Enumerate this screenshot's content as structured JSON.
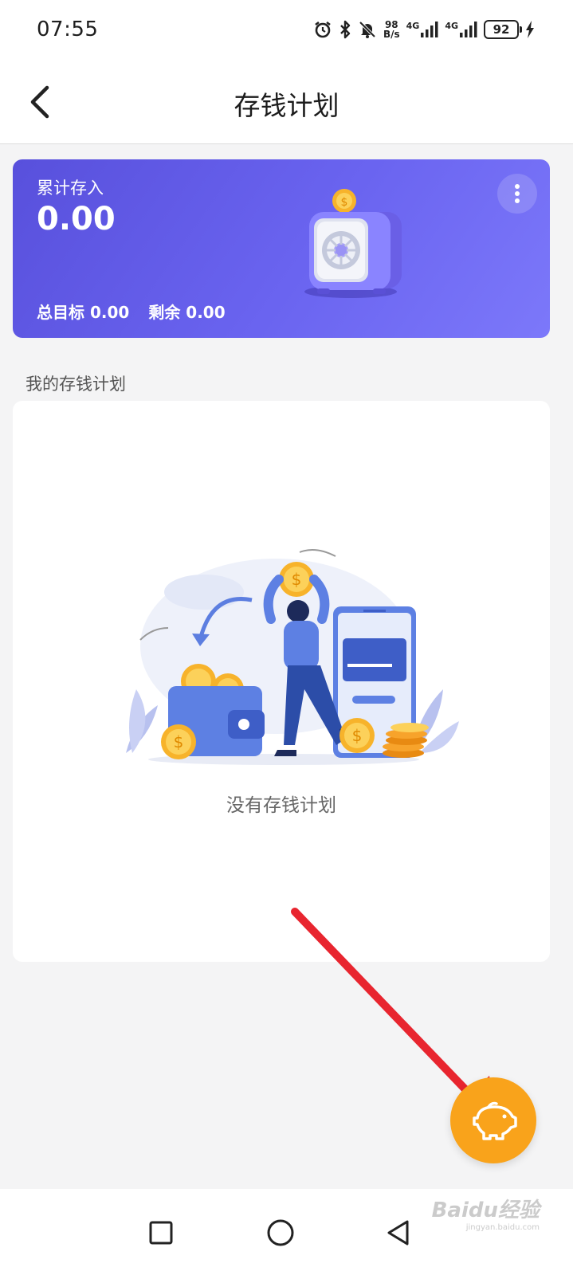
{
  "status_bar": {
    "time": "07:55",
    "net_speed_value": "98",
    "net_speed_unit": "B/s",
    "signal_1_label": "4G",
    "signal_2_label": "4G",
    "battery": "92",
    "icons": [
      "alarm-icon",
      "bluetooth-icon",
      "mute-bell-icon",
      "signal-icon",
      "battery-icon",
      "charging-icon"
    ]
  },
  "header": {
    "title": "存钱计划",
    "back_icon": "chevron-left-icon"
  },
  "summary": {
    "label": "累计存入",
    "amount": "0.00",
    "target_label": "总目标",
    "target_value": "0.00",
    "remaining_label": "剩余",
    "remaining_value": "0.00",
    "more_icon": "more-vertical-icon"
  },
  "plans": {
    "section_title": "我的存钱计划",
    "empty_text": "没有存钱计划"
  },
  "fab": {
    "icon": "piggy-bank-icon"
  },
  "nav": {
    "icons": [
      "recent-apps-icon",
      "home-icon",
      "back-triangle-icon"
    ]
  },
  "watermark": {
    "text": "Baidu经验",
    "sub": "jingyan.baidu.com"
  },
  "colors": {
    "card_gradient_start": "#5850dc",
    "card_gradient_end": "#7c78fa",
    "fab": "#f9a31b",
    "arrow": "#e8252f",
    "background": "#f4f4f5"
  }
}
